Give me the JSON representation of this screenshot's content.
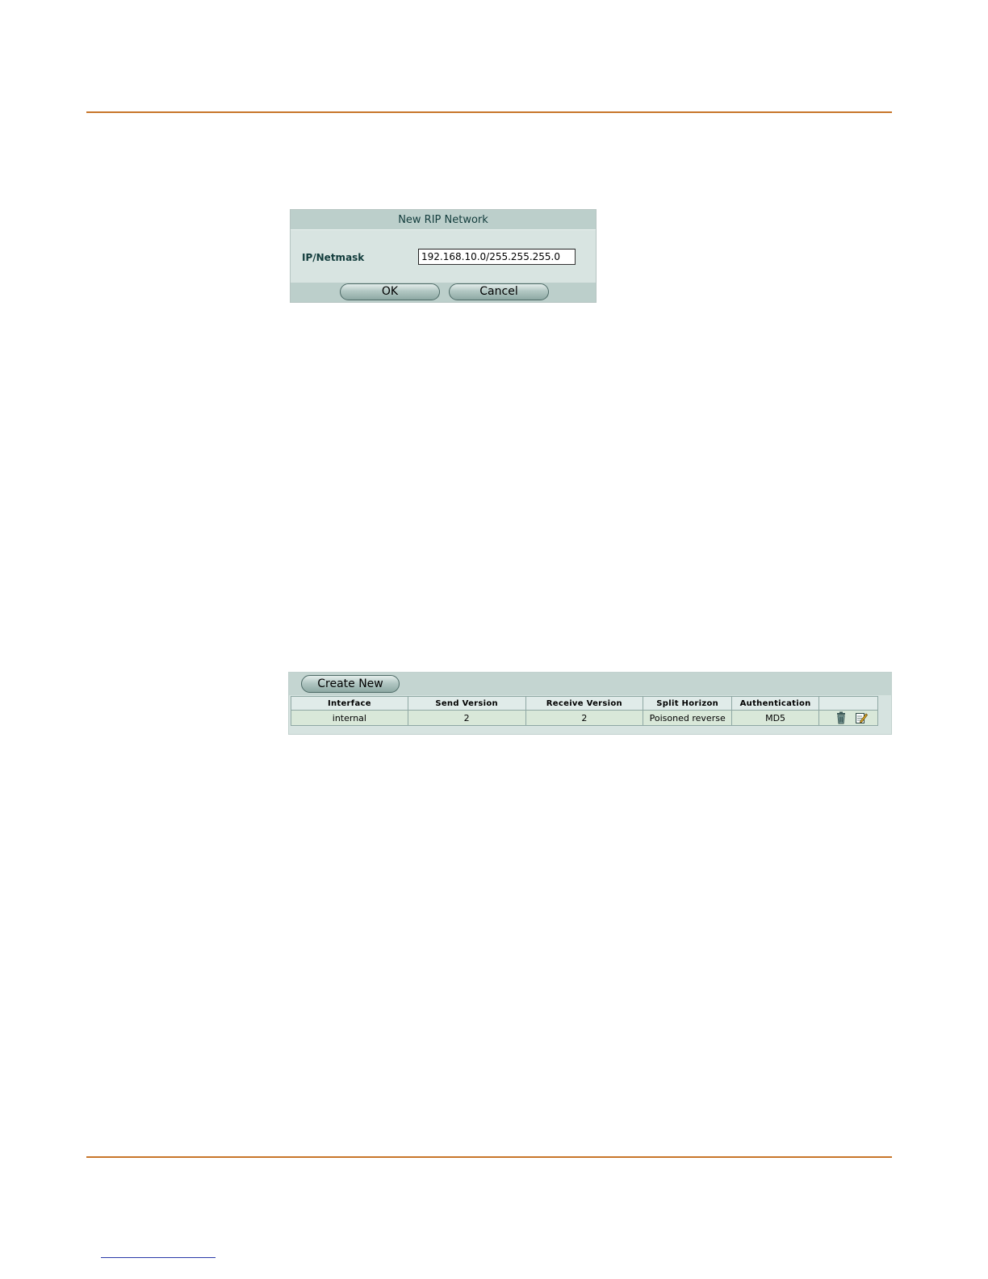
{
  "dialog": {
    "title": "New RIP Network",
    "field_label": "IP/Netmask",
    "field_value": "192.168.10.0/255.255.255.0",
    "ok_label": "OK",
    "cancel_label": "Cancel"
  },
  "interface_list": {
    "create_new_label": "Create New",
    "columns": [
      "Interface",
      "Send Version",
      "Receive Version",
      "Split Horizon",
      "Authentication"
    ],
    "rows": [
      {
        "interface": "internal",
        "send_version": "2",
        "receive_version": "2",
        "split_horizon": "Poisoned reverse",
        "authentication": "MD5",
        "actions": [
          "trash-icon",
          "edit-icon"
        ]
      }
    ]
  },
  "colors": {
    "rule": "#c8762a",
    "panel": "#d6e3e0",
    "header": "#bccfcb",
    "row": "#d9e8d9"
  }
}
